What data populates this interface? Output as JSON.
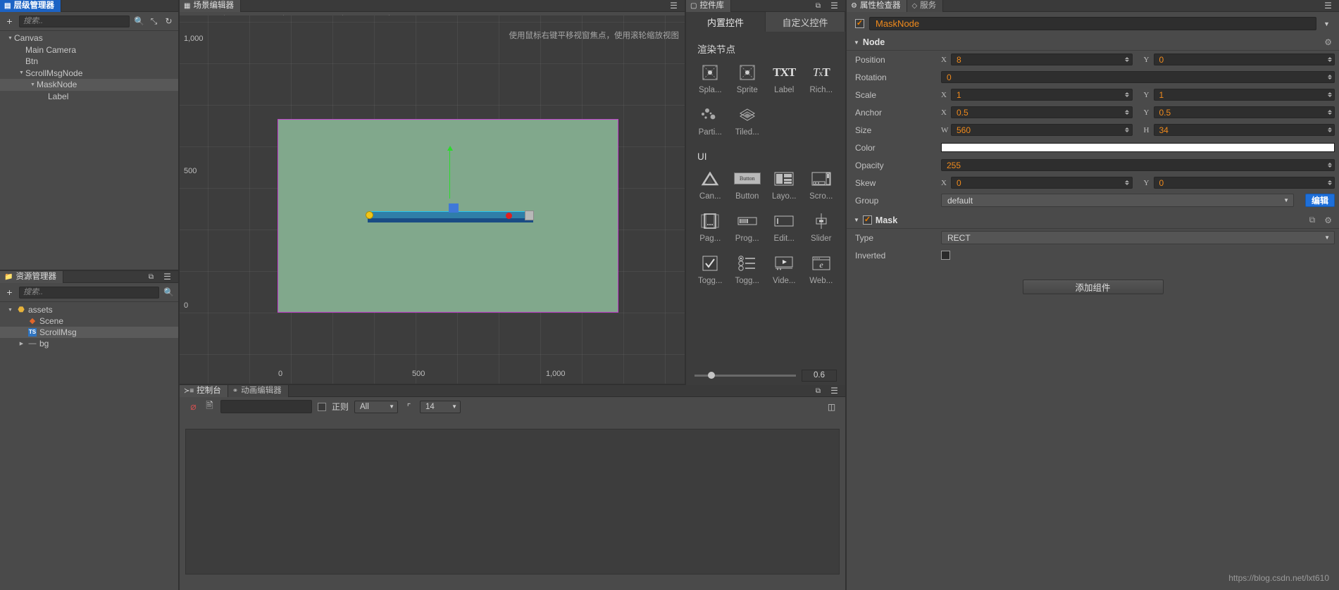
{
  "hierarchy": {
    "tab_label": "层级管理器",
    "search_placeholder": "搜索..",
    "add_icon": "plus-icon",
    "search_icon": "search-icon",
    "expand_icon": "expand-icon",
    "refresh_icon": "refresh-icon",
    "nodes": [
      {
        "label": "Canvas",
        "depth": 0,
        "arrow": "down",
        "selected": false
      },
      {
        "label": "Main Camera",
        "depth": 1,
        "arrow": "none",
        "selected": false
      },
      {
        "label": "Btn",
        "depth": 1,
        "arrow": "none",
        "selected": false
      },
      {
        "label": "ScrollMsgNode",
        "depth": 1,
        "arrow": "down",
        "selected": false
      },
      {
        "label": "MaskNode",
        "depth": 2,
        "arrow": "down",
        "selected": true
      },
      {
        "label": "Label",
        "depth": 3,
        "arrow": "none",
        "selected": false
      }
    ]
  },
  "assets": {
    "tab_label": "资源管理器",
    "search_placeholder": "搜索..",
    "add_icon": "plus-icon",
    "search_icon": "search-icon",
    "copy_icon": "copy-icon",
    "menu_icon": "hamburger-icon",
    "items": [
      {
        "label": "assets",
        "depth": 0,
        "arrow": "down",
        "icon": "folder-assets-icon",
        "selected": false
      },
      {
        "label": "Scene",
        "depth": 1,
        "arrow": "none",
        "icon": "fire-scene-icon",
        "selected": false
      },
      {
        "label": "ScrollMsg",
        "depth": 1,
        "arrow": "none",
        "icon": "typescript-icon",
        "selected": true
      },
      {
        "label": "bg",
        "depth": 1,
        "arrow": "right",
        "icon": "image-icon",
        "selected": false
      }
    ]
  },
  "scene": {
    "tab_label": "场景编辑器",
    "menu_icon": "hamburger-icon",
    "hint": "使用鼠标右键平移视窗焦点，使用滚轮缩放视图",
    "v_ruler_labels": [
      "1,000",
      "500",
      "0"
    ],
    "h_ruler_labels": [
      "0",
      "500",
      "1,000"
    ],
    "toolbar_icons": [
      "zoom-fit-icon",
      "zoom-out-icon",
      "zoom-in-icon",
      "align-left-icon",
      "align-center-h-icon",
      "align-right-icon",
      "distribute-h-icon",
      "align-top-icon",
      "align-middle-v-icon",
      "align-bottom-icon",
      "distribute-v-icon",
      "grid-row-icon",
      "grid-col-icon",
      "grid-both-icon",
      "node-move-icon",
      "node-anchor-icon",
      "node-scale-icon"
    ]
  },
  "console": {
    "tabs": [
      {
        "label": "控制台",
        "icon": "console-icon",
        "active": true
      },
      {
        "label": "动画编辑器",
        "icon": "animation-icon",
        "active": false
      }
    ],
    "clear_icon": "clear-forbidden-icon",
    "file_icon": "file-icon",
    "filter_placeholder": "",
    "filter_value": "",
    "regex_checkbox_label": "正则",
    "regex_checked": false,
    "level_value": "All",
    "font_icon": "font-size-icon",
    "font_size_value": "14",
    "maximize_icon": "maximize-icon",
    "menu_icon": "hamburger-icon"
  },
  "widget_library": {
    "tab_label": "控件库",
    "float_icon": "float-window-icon",
    "menu_icon": "hamburger-icon",
    "tabs": [
      {
        "label": "内置控件",
        "active": true
      },
      {
        "label": "自定义控件",
        "active": false
      }
    ],
    "sections": [
      {
        "title": "渲染节点",
        "items": [
          {
            "label": "Spla...",
            "icon": "splash-icon"
          },
          {
            "label": "Sprite",
            "icon": "sprite-icon"
          },
          {
            "label": "Label",
            "icon": "label-txt-icon"
          },
          {
            "label": "Rich...",
            "icon": "richtext-icon"
          },
          {
            "label": "Parti...",
            "icon": "particle-icon"
          },
          {
            "label": "Tiled...",
            "icon": "tiledmap-icon"
          }
        ]
      },
      {
        "title": "UI",
        "items": [
          {
            "label": "Can...",
            "icon": "canvas-icon"
          },
          {
            "label": "Button",
            "icon": "button-icon"
          },
          {
            "label": "Layo...",
            "icon": "layout-icon"
          },
          {
            "label": "Scro...",
            "icon": "scrollview-icon"
          },
          {
            "label": "Pag...",
            "icon": "pageview-icon"
          },
          {
            "label": "Prog...",
            "icon": "progressbar-icon"
          },
          {
            "label": "Edit...",
            "icon": "editbox-icon"
          },
          {
            "label": "Slider",
            "icon": "slider-icon"
          },
          {
            "label": "Togg...",
            "icon": "toggle-icon"
          },
          {
            "label": "Togg...",
            "icon": "togglegroup-icon"
          },
          {
            "label": "Vide...",
            "icon": "video-icon"
          },
          {
            "label": "Web...",
            "icon": "webview-icon"
          }
        ]
      }
    ],
    "zoom_value": "0.6",
    "zoom_slider_pct": 13
  },
  "inspector": {
    "tabs": [
      {
        "label": "属性检查器",
        "icon": "gear-icon",
        "active": true
      },
      {
        "label": "服务",
        "icon": "service-icon",
        "active": false
      }
    ],
    "node_enabled": true,
    "node_name": "MaskNode",
    "node_section": {
      "title": "Node",
      "gear_icon": "gear-icon",
      "rows": [
        {
          "label": "Position",
          "type": "xy",
          "x": "8",
          "y": "0"
        },
        {
          "label": "Rotation",
          "type": "one",
          "value": "0"
        },
        {
          "label": "Scale",
          "type": "xy",
          "x": "1",
          "y": "1"
        },
        {
          "label": "Anchor",
          "type": "xy",
          "x": "0.5",
          "y": "0.5"
        },
        {
          "label": "Size",
          "type": "wh",
          "w": "560",
          "h": "34"
        },
        {
          "label": "Color",
          "type": "color",
          "value": "#ffffff"
        },
        {
          "label": "Opacity",
          "type": "one",
          "value": "255"
        },
        {
          "label": "Skew",
          "type": "xy",
          "x": "0",
          "y": "0"
        },
        {
          "label": "Group",
          "type": "group",
          "value": "default",
          "button": "编辑"
        }
      ]
    },
    "mask_section": {
      "title": "Mask",
      "enabled": true,
      "copy_icon": "copy-icon",
      "gear_icon": "gear-icon",
      "rows": [
        {
          "label": "Type",
          "type": "select",
          "value": "RECT"
        },
        {
          "label": "Inverted",
          "type": "checkbox",
          "checked": false
        }
      ]
    },
    "add_component_label": "添加组件"
  },
  "watermark": "https://blog.csdn.net/lxt610",
  "colors": {
    "accent_orange": "#f08a1c",
    "accent_blue": "#1e6fd9",
    "tab_blue": "#1c63c4",
    "canvas_green": "#81a88c",
    "canvas_border": "#c43fd0"
  }
}
